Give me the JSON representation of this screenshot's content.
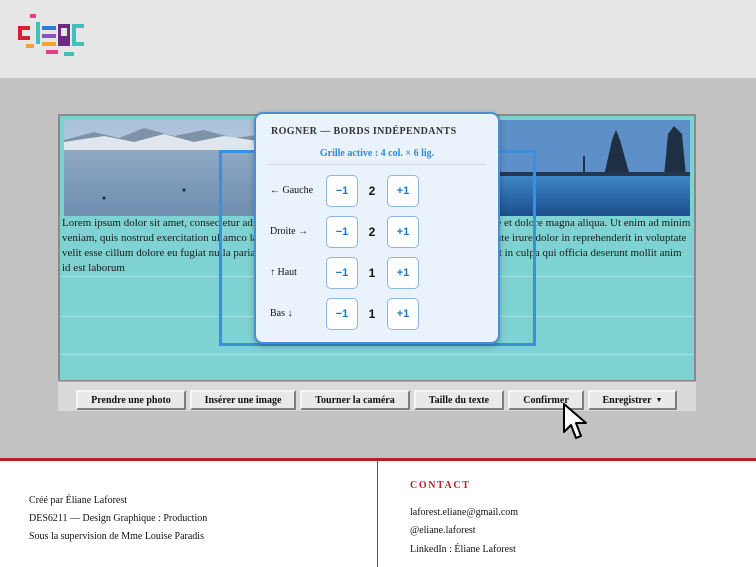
{
  "crop_panel": {
    "title": "ROGNER — BORDS INDÉPENDANTS",
    "grid_status": "Grille active : 4 col. × 6 lig.",
    "minus_label": "−1",
    "plus_label": "+1",
    "edges": [
      {
        "label": "← Gauche",
        "value": "2"
      },
      {
        "label": "Droite →",
        "value": "2"
      },
      {
        "label": "↑ Haut",
        "value": "1"
      },
      {
        "label": "Bas ↓",
        "value": "1"
      }
    ]
  },
  "canvas": {
    "lorem": "Lorem ipsum dolor sit amet, consectetur adipiscing elit, sed do eiusmod tempor incididunt ut labore et dolore magna aliqua. Ut enim ad minim veniam, quis nostrud exercitation ullamco laboris nisi ut aliquip ex ea commodo consequat. Duis aute irure dolor in reprehenderit in voluptate velit esse cillum dolore eu fugiat nulla pariatur. Excepteur sint occaecat cupidatat non proident, sunt in culpa qui officia deserunt mollit anim id est laborum"
  },
  "toolbar": {
    "buttons": [
      {
        "label": "Prendre une photo"
      },
      {
        "label": "Insérer une image"
      },
      {
        "label": "Tourner la caméra"
      },
      {
        "label": "Taille du texte"
      },
      {
        "label": "Confirmer"
      },
      {
        "label": "Enregistrer"
      }
    ]
  },
  "footer": {
    "credits": [
      "Créé par Éliane Laforest",
      "DES6211 — Design Graphique : Production",
      "Sous la supervision de Mme Louise Paradis"
    ],
    "contact_title": "CONTACT",
    "contacts": [
      "laforest.eliane@gmail.com",
      "@eliane.laforest",
      "LinkedIn : Éliane Laforest"
    ]
  },
  "colors": {
    "accent_blue": "#2f8ad6",
    "footer_red": "#b91d2b",
    "canvas_teal": "#7fd2d2"
  },
  "icons": [
    "logo-mark",
    "cursor-arrow-icon",
    "dropdown-caret-icon"
  ]
}
